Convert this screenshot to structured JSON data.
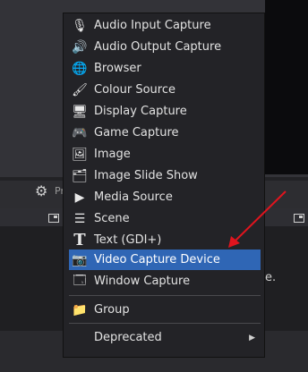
{
  "context_menu": {
    "items": [
      {
        "label": "Audio Input Capture",
        "icon": "microphone-icon"
      },
      {
        "label": "Audio Output Capture",
        "icon": "speaker-icon"
      },
      {
        "label": "Browser",
        "icon": "globe-icon"
      },
      {
        "label": "Colour Source",
        "icon": "brush-icon"
      },
      {
        "label": "Display Capture",
        "icon": "monitor-icon"
      },
      {
        "label": "Game Capture",
        "icon": "gamepad-icon"
      },
      {
        "label": "Image",
        "icon": "image-icon"
      },
      {
        "label": "Image Slide Show",
        "icon": "slideshow-icon"
      },
      {
        "label": "Media Source",
        "icon": "play-icon"
      },
      {
        "label": "Scene",
        "icon": "list-icon"
      },
      {
        "label": "Text (GDI+)",
        "icon": "text-icon"
      },
      {
        "label": "Video Capture Device",
        "icon": "camera-icon"
      },
      {
        "label": "Window Capture",
        "icon": "window-icon"
      }
    ],
    "group": {
      "label": "Group",
      "icon": "folder-icon"
    },
    "deprecated": {
      "label": "Deprecated"
    }
  },
  "background": {
    "toolbar_partial": "Pr",
    "panel_tail": "e."
  },
  "colors": {
    "menu_bg": "#232327",
    "selected": "#2f66b5",
    "annotation_arrow": "#e0141e"
  }
}
